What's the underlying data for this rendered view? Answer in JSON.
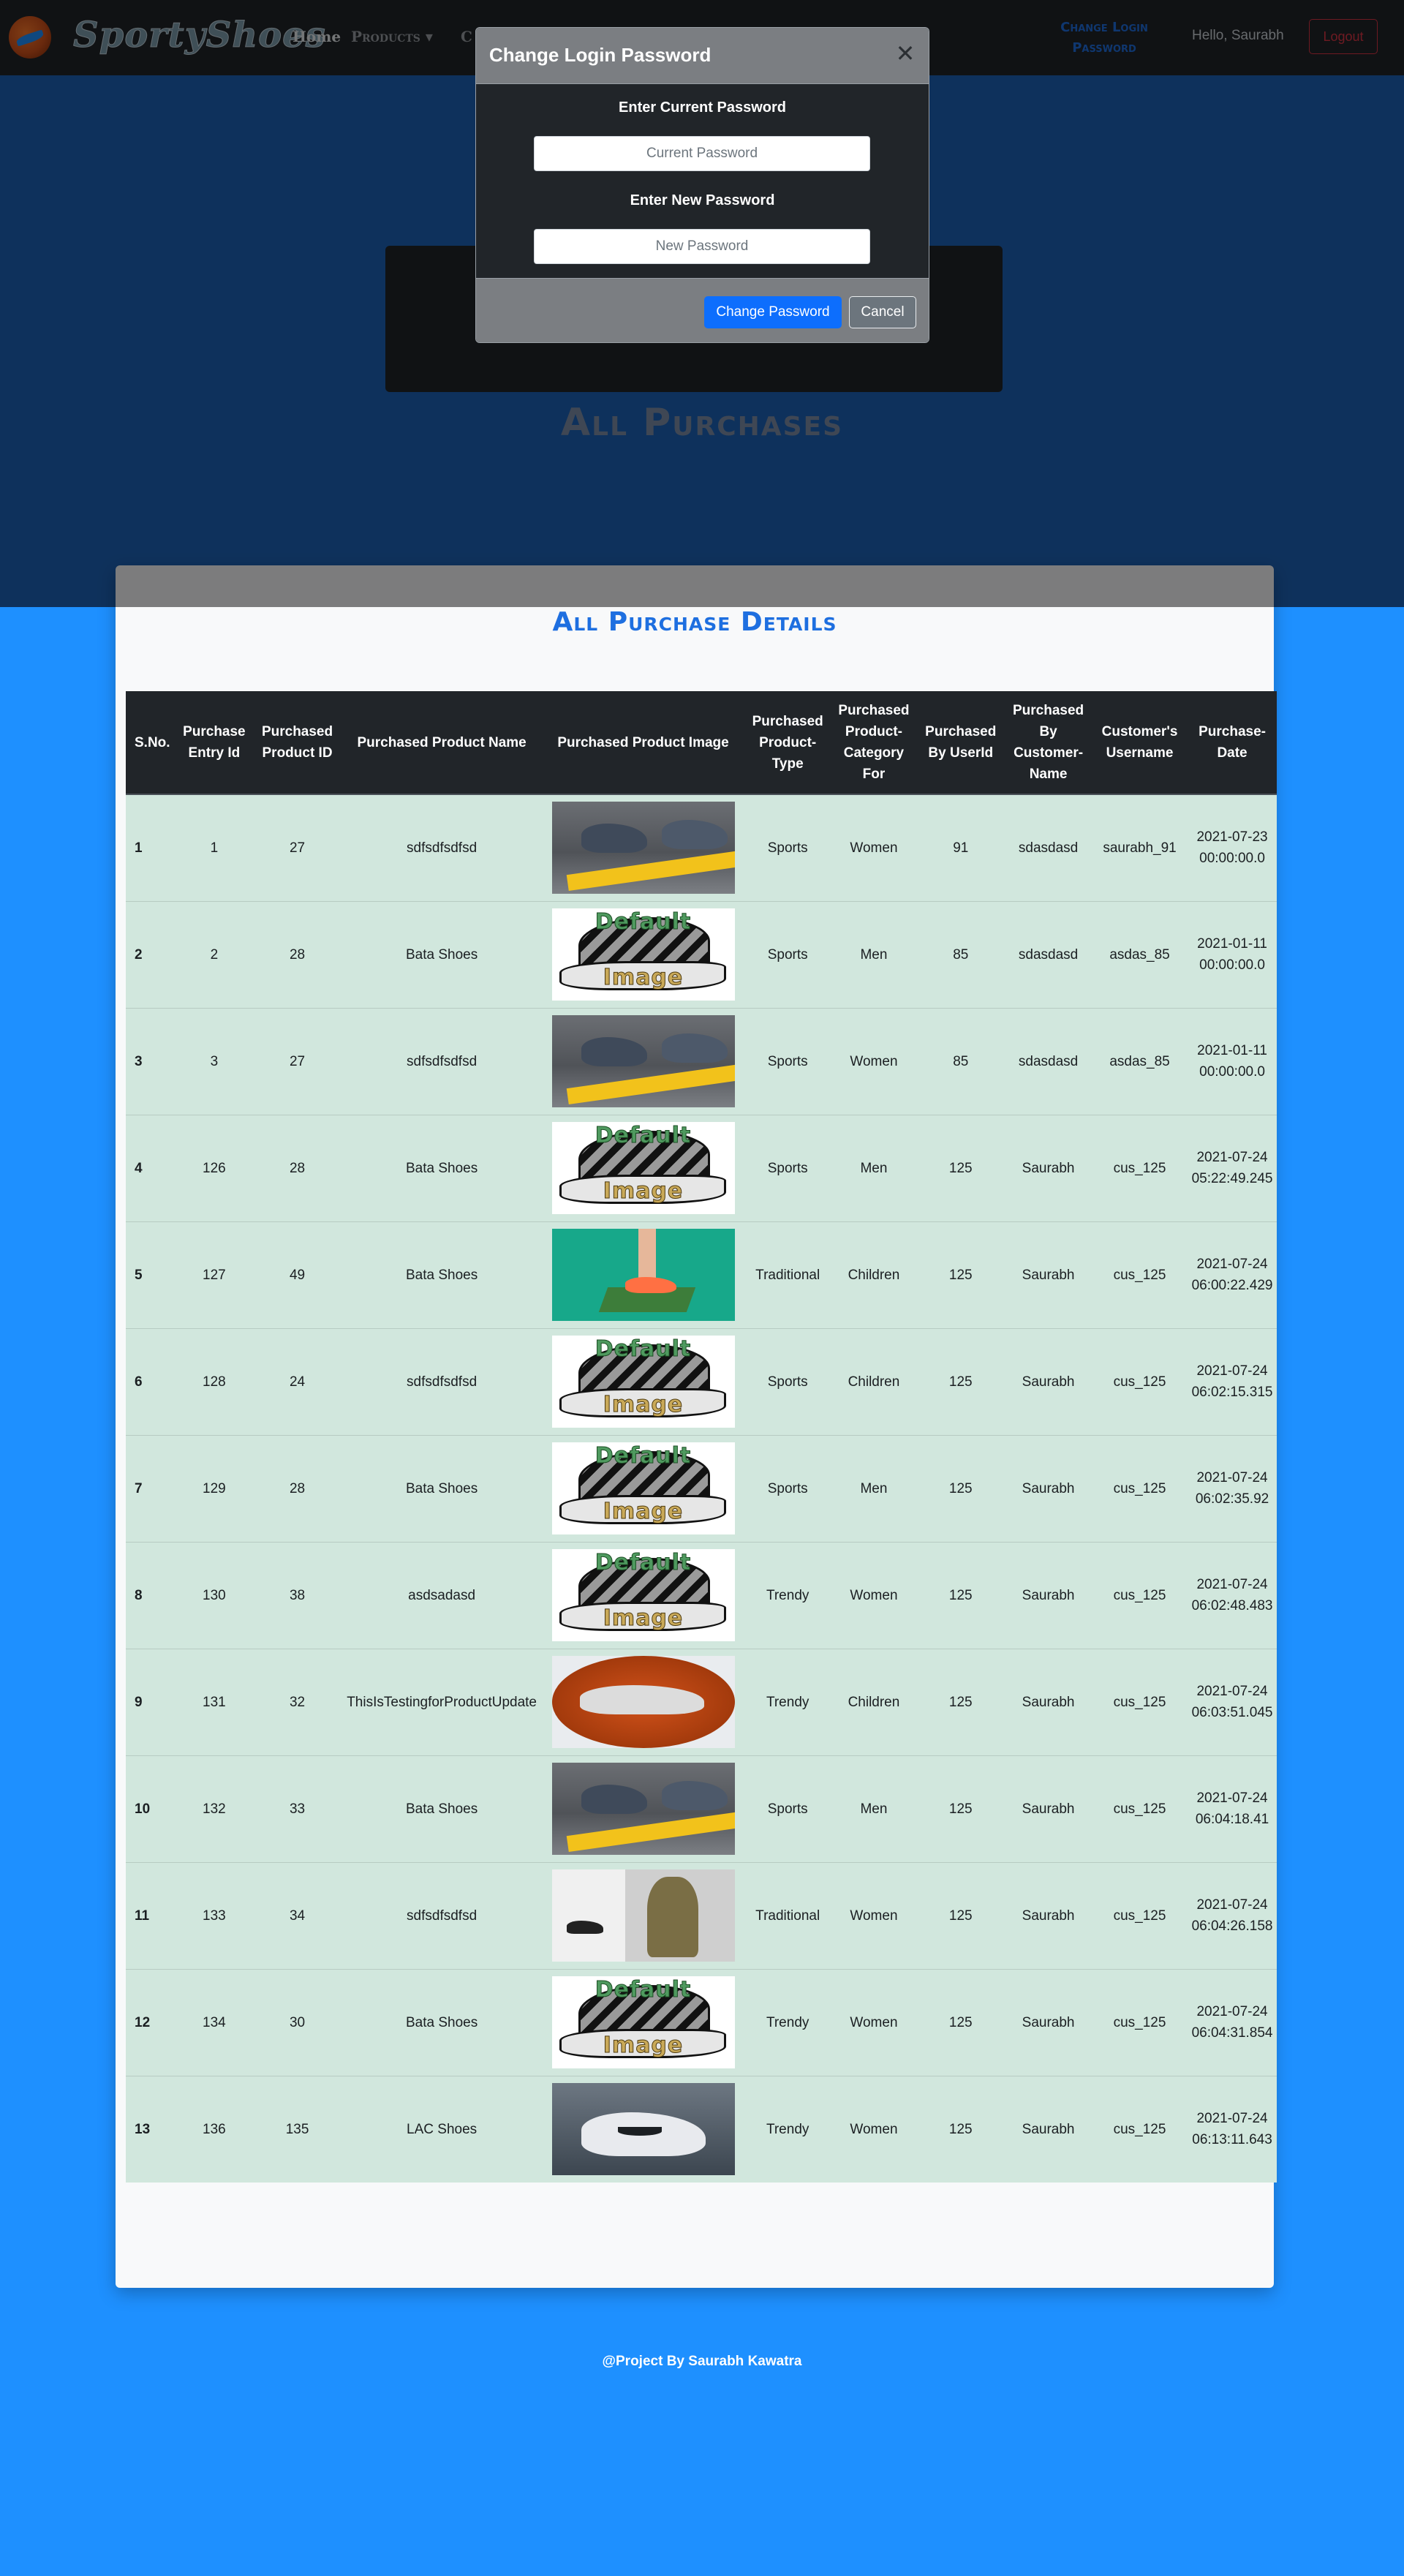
{
  "navbar": {
    "brand": "SportyShoes",
    "home": "Home",
    "products": "Products ▾",
    "partial_link": "C",
    "change_password": "Change Login Password",
    "greeting": "Hello, Saurabh",
    "logout": "Logout"
  },
  "hero": {
    "title": "All Purchases"
  },
  "panel": {
    "title": "All Purchase Details"
  },
  "table": {
    "headers": [
      "S.No.",
      "Purchase Entry Id",
      "Purchased Product ID",
      "Purchased Product Name",
      "Purchased Product Image",
      "Purchased Product-Type",
      "Purchased Product-Category For",
      "Purchased By UserId",
      "Purchased By Customer-Name",
      "Customer's Username",
      "Purchase-Date"
    ],
    "rows": [
      {
        "sno": "1",
        "entry": "1",
        "pid": "27",
        "name": "sdfsdfsdfsd",
        "img": "road",
        "type": "Sports",
        "cat": "Women",
        "uid": "91",
        "cname": "sdasdasd",
        "uname": "saurabh_91",
        "date": "2021-07-23 00:00:00.0"
      },
      {
        "sno": "2",
        "entry": "2",
        "pid": "28",
        "name": "Bata Shoes",
        "img": "default",
        "type": "Sports",
        "cat": "Men",
        "uid": "85",
        "cname": "sdasdasd",
        "uname": "asdas_85",
        "date": "2021-01-11 00:00:00.0"
      },
      {
        "sno": "3",
        "entry": "3",
        "pid": "27",
        "name": "sdfsdfsdfsd",
        "img": "road",
        "type": "Sports",
        "cat": "Women",
        "uid": "85",
        "cname": "sdasdasd",
        "uname": "asdas_85",
        "date": "2021-01-11 00:00:00.0"
      },
      {
        "sno": "4",
        "entry": "126",
        "pid": "28",
        "name": "Bata Shoes",
        "img": "default",
        "type": "Sports",
        "cat": "Men",
        "uid": "125",
        "cname": "Saurabh",
        "uname": "cus_125",
        "date": "2021-07-24 05:22:49.245"
      },
      {
        "sno": "5",
        "entry": "127",
        "pid": "49",
        "name": "Bata Shoes",
        "img": "green",
        "type": "Traditional",
        "cat": "Children",
        "uid": "125",
        "cname": "Saurabh",
        "uname": "cus_125",
        "date": "2021-07-24 06:00:22.429"
      },
      {
        "sno": "6",
        "entry": "128",
        "pid": "24",
        "name": "sdfsdfsdfsd",
        "img": "default",
        "type": "Sports",
        "cat": "Children",
        "uid": "125",
        "cname": "Saurabh",
        "uname": "cus_125",
        "date": "2021-07-24 06:02:15.315"
      },
      {
        "sno": "7",
        "entry": "129",
        "pid": "28",
        "name": "Bata Shoes",
        "img": "default",
        "type": "Sports",
        "cat": "Men",
        "uid": "125",
        "cname": "Saurabh",
        "uname": "cus_125",
        "date": "2021-07-24 06:02:35.92"
      },
      {
        "sno": "8",
        "entry": "130",
        "pid": "38",
        "name": "asdsadasd",
        "img": "default",
        "type": "Trendy",
        "cat": "Women",
        "uid": "125",
        "cname": "Saurabh",
        "uname": "cus_125",
        "date": "2021-07-24 06:02:48.483"
      },
      {
        "sno": "9",
        "entry": "131",
        "pid": "32",
        "name": "ThisIsTestingforProductUpdate",
        "img": "orange",
        "type": "Trendy",
        "cat": "Children",
        "uid": "125",
        "cname": "Saurabh",
        "uname": "cus_125",
        "date": "2021-07-24 06:03:51.045"
      },
      {
        "sno": "10",
        "entry": "132",
        "pid": "33",
        "name": "Bata Shoes",
        "img": "road",
        "type": "Sports",
        "cat": "Men",
        "uid": "125",
        "cname": "Saurabh",
        "uname": "cus_125",
        "date": "2021-07-24 06:04:18.41"
      },
      {
        "sno": "11",
        "entry": "133",
        "pid": "34",
        "name": "sdfsdfsdfsd",
        "img": "store",
        "type": "Traditional",
        "cat": "Women",
        "uid": "125",
        "cname": "Saurabh",
        "uname": "cus_125",
        "date": "2021-07-24 06:04:26.158"
      },
      {
        "sno": "12",
        "entry": "134",
        "pid": "30",
        "name": "Bata Shoes",
        "img": "default",
        "type": "Trendy",
        "cat": "Women",
        "uid": "125",
        "cname": "Saurabh",
        "uname": "cus_125",
        "date": "2021-07-24 06:04:31.854"
      },
      {
        "sno": "13",
        "entry": "136",
        "pid": "135",
        "name": "LAC Shoes",
        "img": "nike",
        "type": "Trendy",
        "cat": "Women",
        "uid": "125",
        "cname": "Saurabh",
        "uname": "cus_125",
        "date": "2021-07-24 06:13:11.643"
      }
    ],
    "default_image_text": [
      "Default",
      "Image"
    ]
  },
  "footer": {
    "text": "@Project By Saurabh Kawatra"
  },
  "modal": {
    "title": "Change Login Password",
    "close_icon": "close-icon",
    "current_label": "Enter Current Password",
    "current_placeholder": "Current Password",
    "new_label": "Enter New Password",
    "new_placeholder": "New Password",
    "change_button": "Change Password",
    "cancel_button": "Cancel"
  },
  "colors": {
    "page_bg": "#1e90ff",
    "hero_bg": "#1d63b8",
    "navbar_bg": "#212529",
    "row_bg": "#d1e7dd",
    "title_blue": "#1e6fe0",
    "primary_button": "#0d6efd",
    "logout_red": "#dc3545"
  }
}
